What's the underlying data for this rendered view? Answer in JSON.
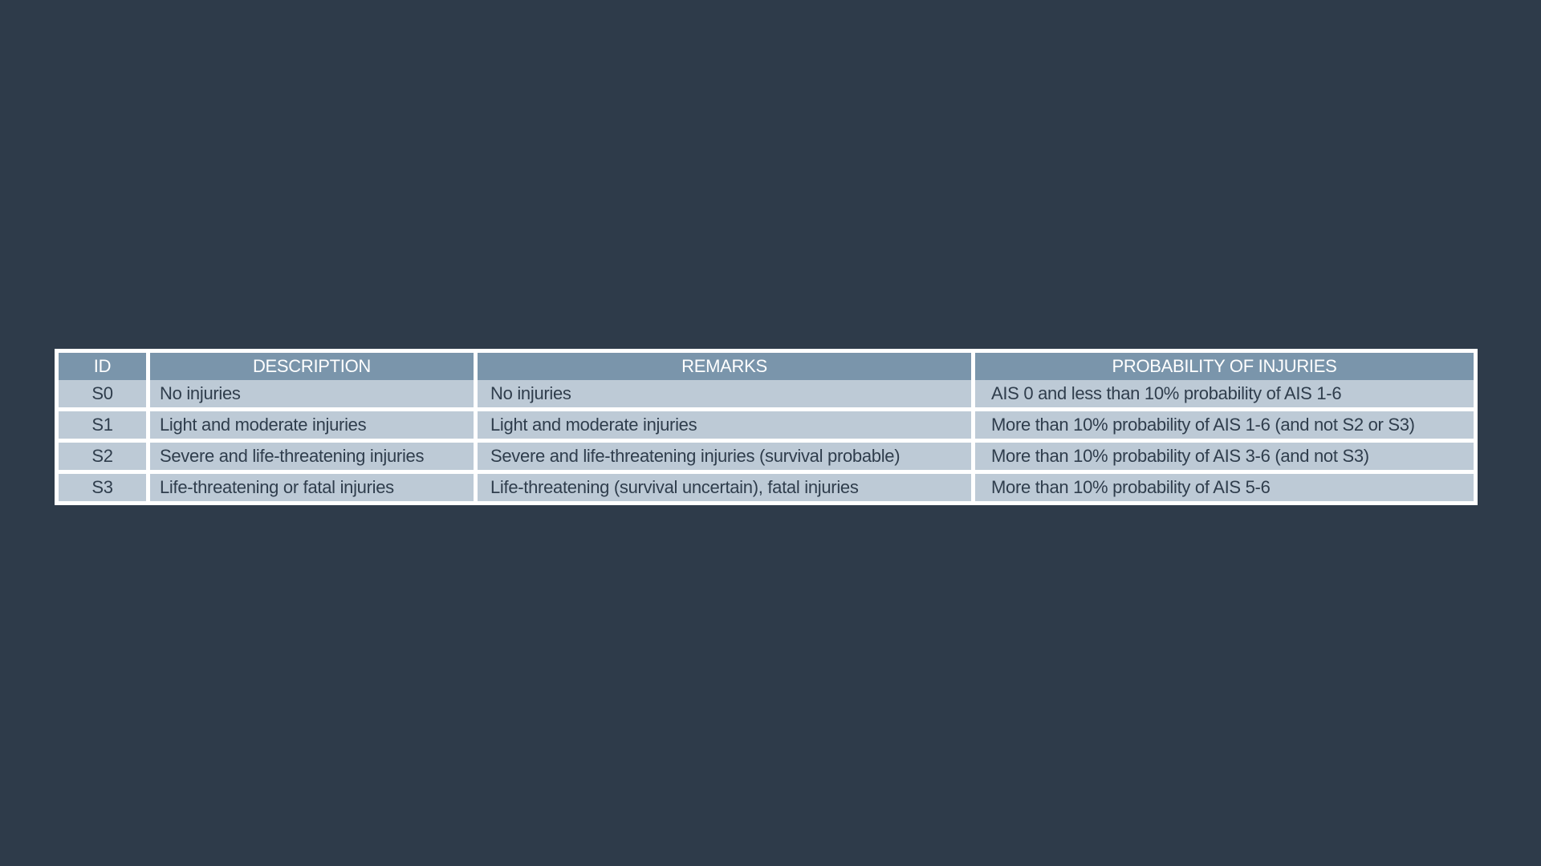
{
  "table": {
    "headers": {
      "id": "ID",
      "description": "DESCRIPTION",
      "remarks": "REMARKS",
      "probability": "PROBABILITY OF INJURIES"
    },
    "rows": [
      {
        "id": "S0",
        "description": "No injuries",
        "remarks": "No injuries",
        "probability": "AIS 0 and less than 10% probability of AIS 1-6"
      },
      {
        "id": "S1",
        "description": "Light and moderate injuries",
        "remarks": "Light and moderate injuries",
        "probability": "More than 10% probability of AIS 1-6 (and not S2 or S3)"
      },
      {
        "id": "S2",
        "description": "Severe and life-threatening injuries",
        "remarks": "Severe and life-threatening injuries (survival probable)",
        "probability": "More than 10% probability of AIS 3-6 (and not S3)"
      },
      {
        "id": "S3",
        "description": "Life-threatening or fatal injuries",
        "remarks": "Life-threatening (survival uncertain), fatal injuries",
        "probability": "More than 10% probability of AIS 5-6"
      }
    ]
  },
  "colors": {
    "background": "#2e3b4a",
    "header_fill": "#7a95ab",
    "cell_fill": "#bdcad6",
    "cell_text": "#2f3d4c",
    "grid_lines": "#ffffff"
  }
}
